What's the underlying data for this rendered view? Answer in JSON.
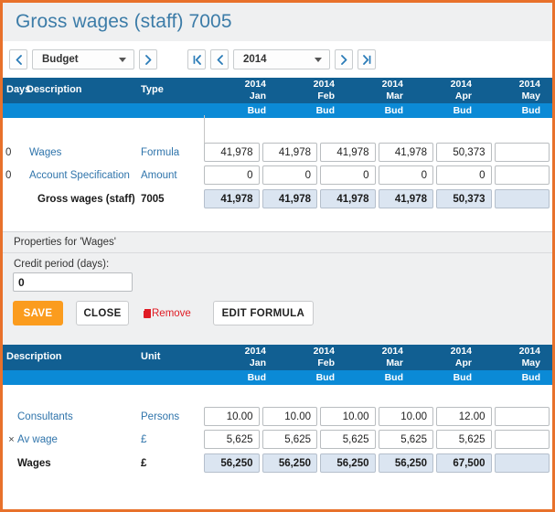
{
  "header": {
    "title": "Gross wages (staff) 7005"
  },
  "toolbar": {
    "scenario_prev_icon": "chevron-left",
    "scenario_value": "Budget",
    "scenario_next_icon": "chevron-right",
    "year_first_icon": "first-page",
    "year_prev_icon": "chevron-left",
    "year_value": "2014",
    "year_next_icon": "chevron-right",
    "year_last_icon": "last-page"
  },
  "grid_top": {
    "columns": {
      "days": "Days",
      "description": "Description",
      "type": "Type"
    },
    "periods": [
      {
        "year": "2014",
        "month": "Jan",
        "version": "Bud"
      },
      {
        "year": "2014",
        "month": "Feb",
        "version": "Bud"
      },
      {
        "year": "2014",
        "month": "Mar",
        "version": "Bud"
      },
      {
        "year": "2014",
        "month": "Apr",
        "version": "Bud"
      },
      {
        "year": "2014",
        "month": "May",
        "version": "Bud"
      }
    ],
    "rows": [
      {
        "days": "0",
        "description": "Wages",
        "type": "Formula",
        "kind": "input",
        "values": [
          "41,978",
          "41,978",
          "41,978",
          "41,978",
          "50,373",
          ""
        ]
      },
      {
        "days": "0",
        "description": "Account Specification",
        "type": "Amount",
        "kind": "input",
        "values": [
          "0",
          "0",
          "0",
          "0",
          "0",
          ""
        ]
      },
      {
        "days": "",
        "description": "Gross wages (staff)",
        "type": "7005",
        "kind": "total",
        "values": [
          "41,978",
          "41,978",
          "41,978",
          "41,978",
          "50,373",
          ""
        ]
      }
    ]
  },
  "properties": {
    "title": "Properties for 'Wages'",
    "field_label": "Credit period (days):",
    "field_value": "0",
    "save_label": "SAVE",
    "close_label": "CLOSE",
    "remove_label": "Remove",
    "remove_icon": "trash-icon",
    "edit_formula_label": "EDIT FORMULA"
  },
  "grid_bottom": {
    "columns": {
      "description": "Description",
      "unit": "Unit"
    },
    "periods": [
      {
        "year": "2014",
        "month": "Jan",
        "version": "Bud"
      },
      {
        "year": "2014",
        "month": "Feb",
        "version": "Bud"
      },
      {
        "year": "2014",
        "month": "Mar",
        "version": "Bud"
      },
      {
        "year": "2014",
        "month": "Apr",
        "version": "Bud"
      },
      {
        "year": "2014",
        "month": "May",
        "version": "Bud"
      }
    ],
    "rows": [
      {
        "operator": "",
        "description": "Consultants",
        "unit": "Persons",
        "kind": "input",
        "values": [
          "10.00",
          "10.00",
          "10.00",
          "10.00",
          "12.00",
          ""
        ]
      },
      {
        "operator": "×",
        "description": "Av wage",
        "unit": "£",
        "kind": "input",
        "values": [
          "5,625",
          "5,625",
          "5,625",
          "5,625",
          "5,625",
          ""
        ]
      },
      {
        "operator": "",
        "description": "Wages",
        "unit": "£",
        "kind": "total",
        "values": [
          "56,250",
          "56,250",
          "56,250",
          "56,250",
          "67,500",
          ""
        ]
      }
    ]
  },
  "colors": {
    "frame_border": "#e8712b",
    "header_dark_blue": "#115f92",
    "header_light_blue": "#0b8ad6",
    "title_blue": "#3c7ca8",
    "save_orange": "#fb9c1e",
    "remove_red": "#e01b24",
    "total_cell": "#dbe5f1"
  }
}
